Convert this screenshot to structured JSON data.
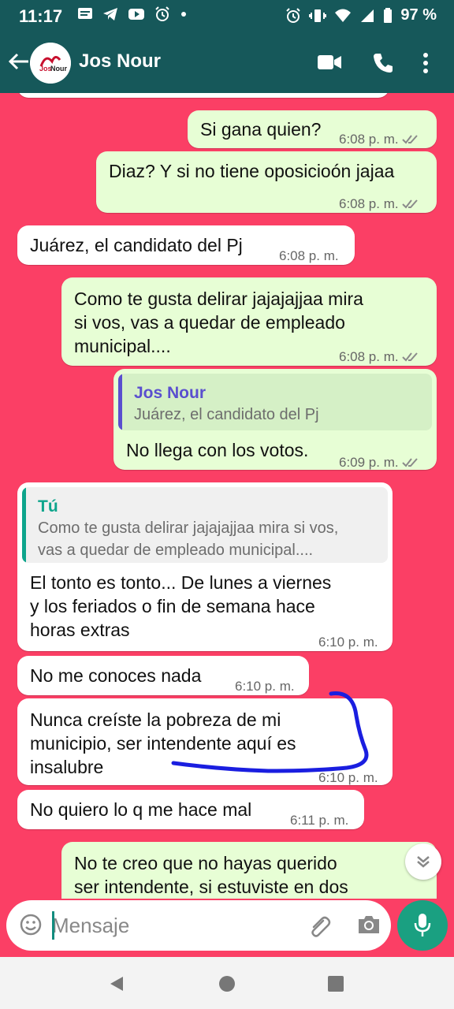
{
  "status_bar": {
    "time": "11:17",
    "battery": "97 %",
    "icons_left": [
      "message-icon",
      "telegram-icon",
      "youtube-icon",
      "alarm-icon",
      "dot-icon"
    ],
    "icons_right": [
      "alarm-icon",
      "vibrate-icon",
      "wifi-icon",
      "signal-icon",
      "battery-icon"
    ]
  },
  "header": {
    "contact_name": "Jos Nour",
    "icons": [
      "back-arrow-icon",
      "video-call-icon",
      "phone-call-icon",
      "more-options-icon"
    ]
  },
  "messages": [
    {
      "direction": "out",
      "text": "Si gana quien?",
      "time": "6:08 p. m.",
      "read": true
    },
    {
      "direction": "out",
      "text": "Diaz? Y si no tiene oposicioón jajaa",
      "time": "6:08 p. m.",
      "read": true
    },
    {
      "direction": "in",
      "text": "Juárez, el candidato del Pj",
      "time": "6:08 p. m."
    },
    {
      "direction": "out",
      "text_lines": [
        "Como te gusta delirar jajajajjaa mira",
        "si vos, vas a quedar de empleado",
        "municipal...."
      ],
      "time": "6:08 p. m.",
      "read": true
    },
    {
      "direction": "out",
      "quote": {
        "author": "Jos Nour",
        "text": "Juárez, el candidato del Pj"
      },
      "text": "No llega con los votos.",
      "time": "6:09 p. m.",
      "read": true
    },
    {
      "direction": "in",
      "quote": {
        "author": "Tú",
        "text_lines": [
          "Como te gusta delirar jajajajjaa mira si vos,",
          "vas a quedar de empleado municipal...."
        ]
      },
      "text_lines": [
        "El tonto es tonto... De lunes a viernes",
        "y los feriados o fin de semana hace",
        "horas extras"
      ],
      "time": "6:10 p. m."
    },
    {
      "direction": "in",
      "text": "No me conoces nada",
      "time": "6:10 p. m."
    },
    {
      "direction": "in",
      "text_lines": [
        "Nunca creíste la pobreza de mi",
        "municipio, ser intendente aquí es",
        "insalubre"
      ],
      "time": "6:10 p. m."
    },
    {
      "direction": "in",
      "text": "No quiero lo q me hace mal",
      "time": "6:11 p. m."
    },
    {
      "direction": "out",
      "text_lines": [
        "No  te creo que no hayas querido",
        "ser intendente, si estuviste en dos"
      ]
    }
  ],
  "composer": {
    "placeholder": "Mensaje",
    "icons": [
      "emoji-icon",
      "attach-icon",
      "camera-icon",
      "mic-icon"
    ]
  },
  "colors": {
    "chat_background": "#fb3f65",
    "header": "#16585a",
    "outgoing_bubble": "#e7fed5",
    "incoming_bubble": "#ffffff",
    "quote_author_out": "#5a4fcf",
    "quote_author_in": "#0ea58c",
    "annotation_stroke": "#1a1ee0",
    "accent": "#1aa081"
  }
}
